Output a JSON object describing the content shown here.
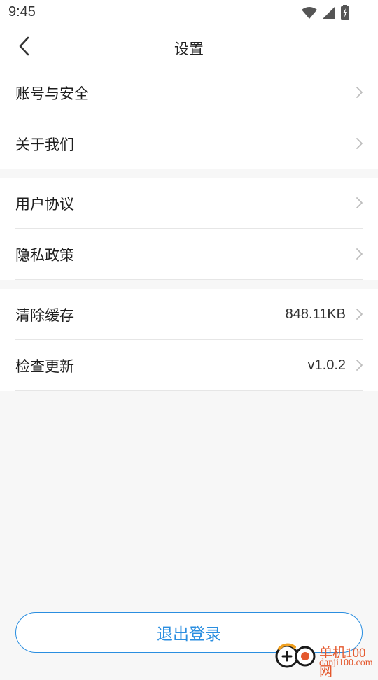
{
  "status_bar": {
    "time": "9:45",
    "icons": [
      "wifi-icon",
      "signal-icon",
      "battery-charging-icon"
    ]
  },
  "header": {
    "title": "设置",
    "back_icon": "chevron-left-icon"
  },
  "groups": [
    {
      "items": [
        {
          "label": "账号与安全"
        },
        {
          "label": "关于我们"
        }
      ]
    },
    {
      "items": [
        {
          "label": "用户协议"
        },
        {
          "label": "隐私政策"
        }
      ]
    },
    {
      "items": [
        {
          "label": "清除缓存",
          "value": "848.11KB"
        },
        {
          "label": "检查更新",
          "value": "v1.0.2"
        }
      ]
    }
  ],
  "logout": {
    "label": "退出登录"
  },
  "watermark": {
    "name": "单机100网",
    "url": "danji100.com"
  },
  "colors": {
    "accent": "#2a8ee0",
    "background": "#f7f7f7",
    "watermark": "#e4582d"
  }
}
